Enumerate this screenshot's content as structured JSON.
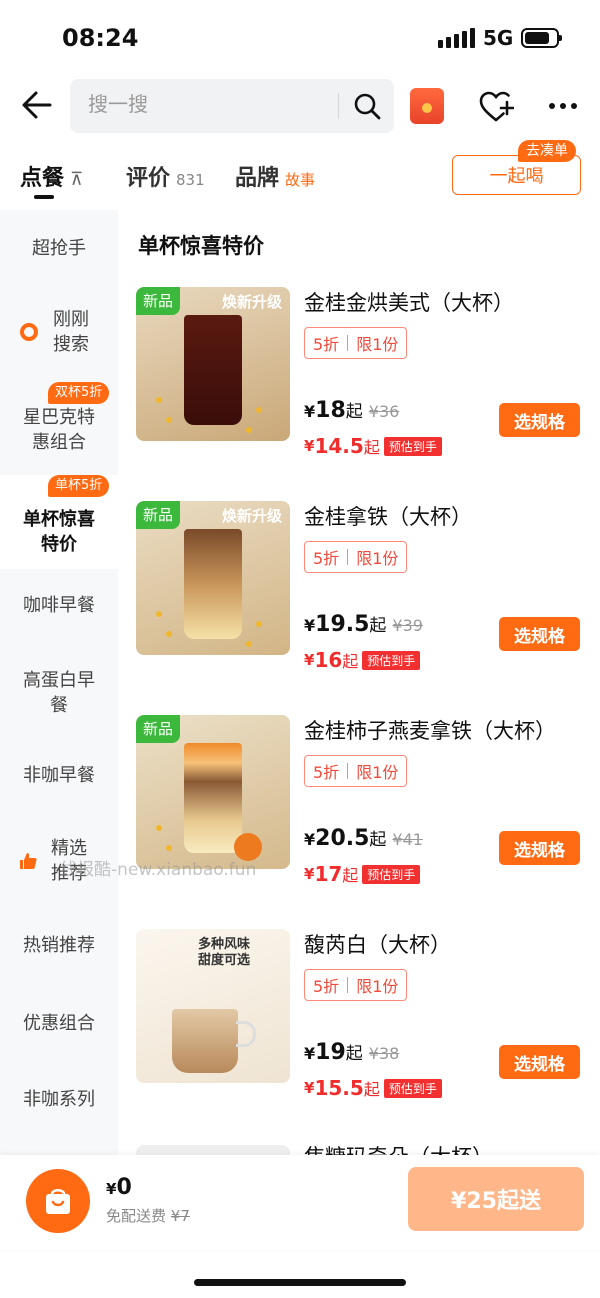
{
  "status_bar": {
    "time": "08:24",
    "network": "5G"
  },
  "header": {
    "search_placeholder": "搜一搜"
  },
  "tabs": {
    "order": "点餐",
    "order_pin": "⊼",
    "reviews": "评价",
    "reviews_count": "831",
    "brand": "品牌",
    "brand_story": "故事",
    "group_order": "一起喝",
    "group_tag": "去凑单"
  },
  "sidebar": {
    "items": [
      {
        "label": "超抢手"
      },
      {
        "label": "刚刚\n搜索"
      },
      {
        "label": "星巴克特\n惠组合",
        "badge": "双杯5折"
      },
      {
        "label": "单杯惊喜\n特价",
        "badge": "单杯5折"
      },
      {
        "label": "咖啡早餐"
      },
      {
        "label": "高蛋白早\n餐"
      },
      {
        "label": "非咖早餐"
      },
      {
        "label": "精选\n推荐"
      },
      {
        "label": "热销推荐"
      },
      {
        "label": "优惠组合"
      },
      {
        "label": "非咖系列"
      }
    ]
  },
  "section_title": "单杯惊喜特价",
  "products": [
    {
      "name": "金桂金烘美式（大杯）",
      "new_tag": "新品",
      "upgrade_tag": "焕新升级",
      "discount": "5折",
      "limit": "限1份",
      "price": "18",
      "price_suffix": "起",
      "original_price": "¥36",
      "est_price": "14.5",
      "est_suffix": "起",
      "est_tag": "预估到手",
      "button": "选规格"
    },
    {
      "name": "金桂拿铁（大杯）",
      "new_tag": "新品",
      "upgrade_tag": "焕新升级",
      "discount": "5折",
      "limit": "限1份",
      "price": "19.5",
      "price_suffix": "起",
      "original_price": "¥39",
      "est_price": "16",
      "est_suffix": "起",
      "est_tag": "预估到手",
      "button": "选规格"
    },
    {
      "name": "金桂柿子燕麦拿铁（大杯）",
      "new_tag": "新品",
      "upgrade_tag": "",
      "discount": "5折",
      "limit": "限1份",
      "price": "20.5",
      "price_suffix": "起",
      "original_price": "¥41",
      "est_price": "17",
      "est_suffix": "起",
      "est_tag": "预估到手",
      "button": "选规格"
    },
    {
      "name": "馥芮白（大杯）",
      "new_tag": "",
      "upgrade_tag": "",
      "img_text": "多种风味\n甜度可选",
      "discount": "5折",
      "limit": "限1份",
      "price": "19",
      "price_suffix": "起",
      "original_price": "¥38",
      "est_price": "15.5",
      "est_suffix": "起",
      "est_tag": "预估到手",
      "button": "选规格"
    }
  ],
  "partial_product_name": "焦糖玛奇朵（大杯）",
  "watermark": "线报酷-new.xianbao.fun",
  "currency": "¥",
  "cart": {
    "total": "0",
    "fee_label": "免配送费",
    "fee_original": "¥7",
    "checkout": "¥25起送"
  },
  "colors": {
    "accent": "#ff6a13",
    "price_red": "#f02d2d",
    "new_green": "#3cb83c"
  }
}
